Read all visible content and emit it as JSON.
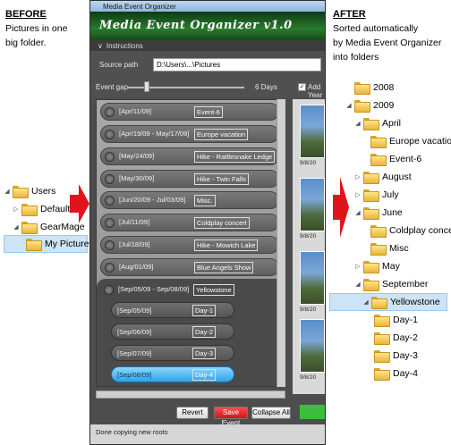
{
  "before": {
    "title": "BEFORE",
    "desc": [
      "Pictures in one",
      "big folder."
    ],
    "tree": [
      "Users",
      "Default",
      "GearMage",
      "My Pictures"
    ]
  },
  "after": {
    "title": "AFTER",
    "desc": [
      "Sorted automatically",
      "by Media Event Organizer",
      "into folders"
    ],
    "tree": [
      "2008",
      "2009",
      "April",
      "Europe vacation",
      "Event-6",
      "August",
      "July",
      "June",
      "Coldplay concert",
      "Misc",
      "May",
      "September",
      "Yellowstone",
      "Day-1",
      "Day-2",
      "Day-3",
      "Day-4"
    ]
  },
  "app": {
    "window_title": "Media Event Organizer",
    "banner": "Media Event Organizer v1.0",
    "instructions": "Instructions",
    "source_path_label": "Source path",
    "source_path": "D:\\Users\\...\\Pictures",
    "event_gap_label": "Event gap",
    "event_gap_value": "6 Days",
    "add_year_label": "Add Year",
    "events": [
      {
        "date": "[Apr/11/09]",
        "name": "Event-6"
      },
      {
        "date": "[Apr/19/09 - May/17/09]",
        "name": "Europe vacation"
      },
      {
        "date": "[May/24/09]",
        "name": "Hike - Rattlesnake Ledge"
      },
      {
        "date": "[May/30/09]",
        "name": "Hike - Twin Falls"
      },
      {
        "date": "[Jun/20/09 - Jul/03/09]",
        "name": "Misc."
      },
      {
        "date": "[Jul/11/09]",
        "name": "Coldplay concert"
      },
      {
        "date": "[Jul/18/09]",
        "name": "Hike - Mowich Lake"
      },
      {
        "date": "[Aug/01/09]",
        "name": "Blue Angels Show"
      },
      {
        "date": "[Sep/05/09 - Sep/08/09]",
        "name": "Yellowstone"
      }
    ],
    "days": [
      {
        "date": "[Sep/05/09]",
        "name": "Day-1"
      },
      {
        "date": "[Sep/06/09]",
        "name": "Day-2"
      },
      {
        "date": "[Sep/07/09]",
        "name": "Day-3"
      },
      {
        "date": "[Sep/08/09]",
        "name": "Day-4"
      }
    ],
    "thumb_captions": [
      "9/8/20",
      "9/8/20",
      "9/8/20",
      "9/8/20",
      "9/8/20"
    ],
    "buttons": {
      "revert": "Revert",
      "save": "Save Event",
      "collapse": "Collapse All"
    },
    "status": "Done copying new roots"
  }
}
